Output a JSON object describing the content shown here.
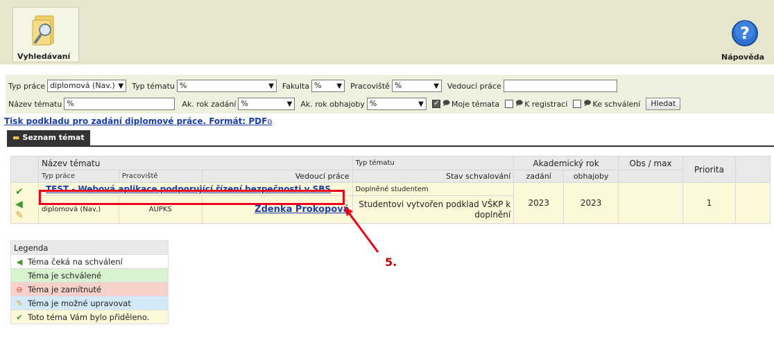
{
  "toolbar": {
    "search_label": "Vyhledávaní",
    "help_label": "Nápověda",
    "help_glyph": "?"
  },
  "filters": {
    "row1": {
      "typ_prace_label": "Typ práce",
      "typ_prace_value": "diplomová (Nav.)",
      "typ_tematu_label": "Typ tématu",
      "typ_tematu_value": "%",
      "fakulta_label": "Fakulta",
      "fakulta_value": "%",
      "pracoviste_label": "Pracoviště",
      "pracoviste_value": "%",
      "vedouci_label": "Vedoucí práce",
      "vedouci_value": ""
    },
    "row2": {
      "nazev_label": "Název tématu",
      "nazev_value": "%",
      "ak_zadani_label": "Ak. rok zadání",
      "ak_zadani_value": "%",
      "ak_obhajoby_label": "Ak. rok obhajoby",
      "ak_obhajoby_value": "%",
      "moje_temata_label": "Moje témata",
      "moje_temata_checked": true,
      "k_registraci_label": "K registraci",
      "k_registraci_checked": false,
      "ke_schvaleni_label": "Ke schválení",
      "ke_schvaleni_checked": false,
      "search_button": "Hledat"
    }
  },
  "print_link": "Tisk podkladu pro zadání diplomové práce. Formát: PDF",
  "tab_label": "Seznam témat",
  "table": {
    "header": {
      "nazev": "Název tématu",
      "typ_prace": "Typ práce",
      "pracoviste": "Pracoviště",
      "vedouci": "Vedoucí práce",
      "typ_tematu": "Typ tématu",
      "stav": "Stav schvalování",
      "akademicky_rok": "Akademický rok",
      "zadani": "zadání",
      "obhajoby": "obhajoby",
      "obs_max": "Obs / max",
      "priorita": "Priorita"
    },
    "row": {
      "title": "TEST - Webová aplikace podporující řízení bezpečnosti v SBS",
      "typ_tematu": "Doplněné studentem",
      "typ_prace": "diplomová (Nav.)",
      "pracoviste": "AUPKS",
      "vedouci": "Zdenka Prokopová",
      "stav": "Studentovi vytvořen podklad VŠKP k doplnění",
      "zadani": "2023",
      "obhajoby": "2023",
      "obs_max": "",
      "priorita": "1"
    }
  },
  "annotation_label": "5.",
  "legend": {
    "title": "Legenda",
    "items": [
      {
        "text": "Téma čeká na schválení",
        "bg": "#ffffff"
      },
      {
        "text": "Téma je schválené",
        "bg": "#d9f2d0"
      },
      {
        "text": "Téma je zamítnuté",
        "bg": "#f6d1ca"
      },
      {
        "text": "Téma je možné upravovat",
        "bg": "#d3e9f7"
      },
      {
        "text": "Toto téma Vám bylo přiděleno.",
        "bg": "#fdf8d8"
      }
    ]
  },
  "colors": {
    "toolbar_bg": "#e6e6cf",
    "link": "#1a3fa8",
    "highlight": "#e8001c",
    "row_bg": "#fdf8d8"
  }
}
